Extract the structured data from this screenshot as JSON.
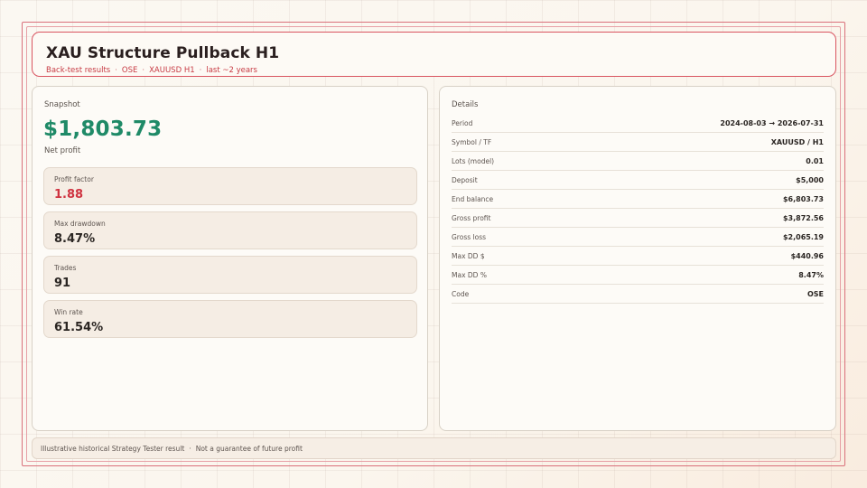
{
  "header": {
    "title": "XAU Structure Pullback H1",
    "subtitle_parts": [
      "Back-test results",
      "OSE",
      "XAUUSD H1",
      "last ~2 years"
    ],
    "separator": "·"
  },
  "snapshot": {
    "label": "Snapshot",
    "net_profit_value": "$1,803.73",
    "net_profit_label": "Net profit",
    "stats": [
      {
        "label": "Profit factor",
        "value": "1.88"
      },
      {
        "label": "Max drawdown",
        "value": "8.47%"
      },
      {
        "label": "Trades",
        "value": "91"
      },
      {
        "label": "Win rate",
        "value": "61.54%"
      }
    ]
  },
  "details": {
    "label": "Details",
    "rows": [
      {
        "key": "Period",
        "value": "2024-08-03 → 2026-07-31"
      },
      {
        "key": "Symbol / TF",
        "value": "XAUUSD / H1"
      },
      {
        "key": "Lots (model)",
        "value": "0.01"
      },
      {
        "key": "Deposit",
        "value": "$5,000"
      },
      {
        "key": "End balance",
        "value": "$6,803.73"
      },
      {
        "key": "Gross profit",
        "value": "$3,872.56"
      },
      {
        "key": "Gross loss",
        "value": "$2,065.19"
      },
      {
        "key": "Max DD $",
        "value": "$440.96"
      },
      {
        "key": "Max DD %",
        "value": "8.47%"
      },
      {
        "key": "Code",
        "value": "OSE"
      }
    ]
  },
  "footer": {
    "parts": [
      "Illustrative historical Strategy Tester result",
      "Not a guarantee of future profit"
    ],
    "separator": "·"
  },
  "colors": {
    "accent_red": "#cf3340",
    "profit_green": "#1f8a67",
    "frame_red": "#d95460"
  }
}
